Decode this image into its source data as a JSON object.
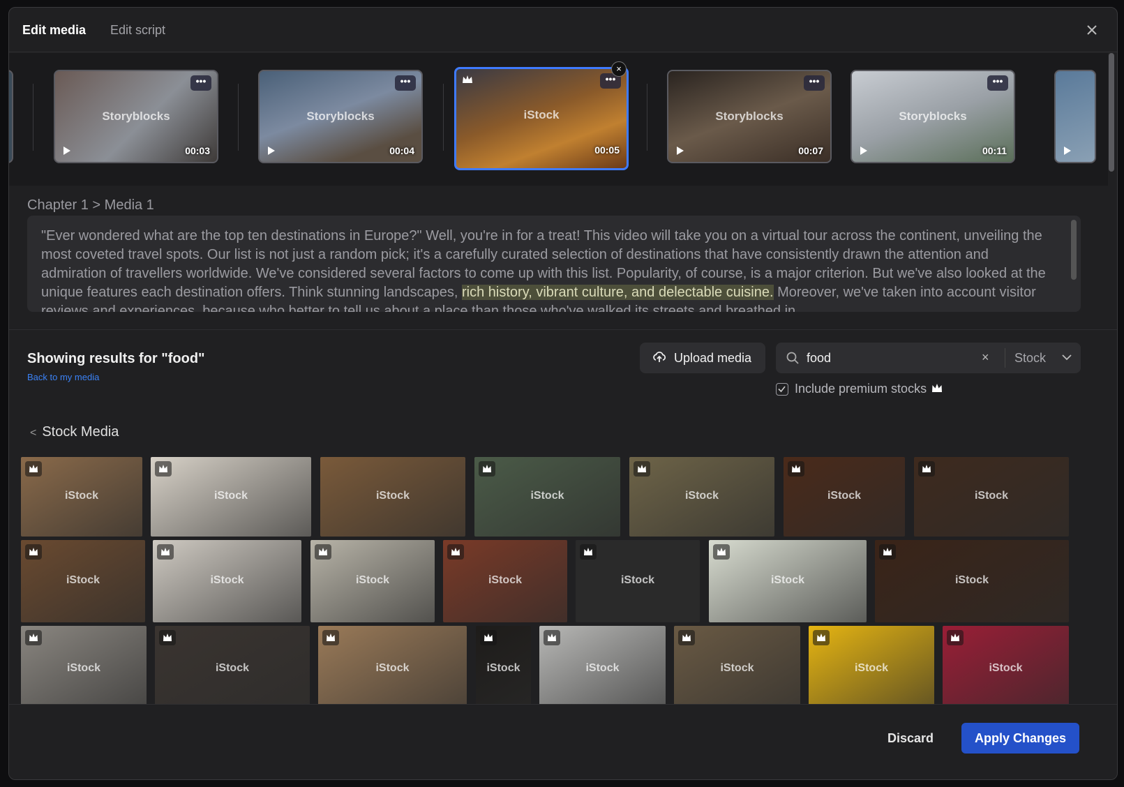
{
  "header": {
    "tabs": [
      {
        "label": "Edit media",
        "active": true
      },
      {
        "label": "Edit script",
        "active": false
      }
    ],
    "close_icon": "close-icon"
  },
  "timeline": {
    "items": [
      {
        "source": "Storyblocks",
        "duration": "00:03",
        "selected": false
      },
      {
        "source": "Storyblocks",
        "duration": "00:04",
        "selected": false
      },
      {
        "source": "iStock",
        "duration": "00:05",
        "selected": true
      },
      {
        "source": "Storyblocks",
        "duration": "00:07",
        "selected": false
      },
      {
        "source": "Storyblocks",
        "duration": "00:11",
        "selected": false
      }
    ],
    "more_label": "•••",
    "remove_label": "×"
  },
  "breadcrumb": {
    "chapter": "Chapter 1",
    "separator": ">",
    "media": "Media 1"
  },
  "script": {
    "before": "\"Ever wondered what are the top ten destinations in Europe?\" Well, you're in for a treat! This video will take you on a virtual tour across the continent, unveiling the most coveted travel spots. Our list is not just a random pick; it's a carefully curated selection of destinations that have consistently drawn the attention and admiration of travellers worldwide. We've considered several factors to come up with this list. Popularity, of course, is a major criterion. But we've also looked at the unique features each destination offers. Think stunning landscapes, ",
    "highlight": "rich history, vibrant culture, and delectable cuisine.",
    "after": " Moreover, we've taken into account visitor reviews and experiences, because who better to tell us about a place than those who've walked its streets and breathed in"
  },
  "results": {
    "title": "Showing results for \"food\"",
    "back_link": "Back to my media"
  },
  "upload": {
    "label": "Upload media",
    "icon": "cloud-upload-icon"
  },
  "search": {
    "value": "food",
    "clear": "×",
    "source": "Stock",
    "icon": "search-icon"
  },
  "premium": {
    "label": "Include premium stocks",
    "checked": true
  },
  "stock_section": {
    "title": "Stock Media",
    "back_icon": "chevron-left-icon"
  },
  "stock_grid": {
    "watermark": "iStock",
    "rows": [
      [
        {
          "color": "#8a6a4a",
          "premium": true
        },
        {
          "color": "#d8d2c8",
          "premium": true
        },
        {
          "color": "#7a5a3a",
          "premium": false
        },
        {
          "color": "#4b5b48",
          "premium": true
        },
        {
          "color": "#6e6448",
          "premium": true
        },
        {
          "color": "#4a2a1a",
          "premium": true
        },
        {
          "color": "#3e2a1e",
          "premium": true
        }
      ],
      [
        {
          "color": "#6a4a30",
          "premium": true
        },
        {
          "color": "#cfcac2",
          "premium": true
        },
        {
          "color": "#b8b4a8",
          "premium": true
        },
        {
          "color": "#7a3a28",
          "premium": true
        },
        {
          "color": "#2a2a2a",
          "premium": true
        },
        {
          "color": "#d8dcd0",
          "premium": true
        },
        {
          "color": "#3a2418",
          "premium": true
        }
      ],
      [
        {
          "color": "#8a8680",
          "premium": true
        },
        {
          "color": "#3a3430",
          "premium": true
        },
        {
          "color": "#9a7a58",
          "premium": true
        },
        {
          "color": "#1e1c1a",
          "premium": true
        },
        {
          "color": "#b8b8b6",
          "premium": true
        },
        {
          "color": "#6a5a44",
          "premium": true
        },
        {
          "color": "#e6b512",
          "premium": true
        },
        {
          "color": "#9a1e36",
          "premium": true
        }
      ]
    ]
  },
  "footer": {
    "discard": "Discard",
    "apply": "Apply Changes"
  },
  "colors": {
    "accent": "#2451c9",
    "selected_border": "#3f7bff",
    "link": "#3b82f6"
  }
}
